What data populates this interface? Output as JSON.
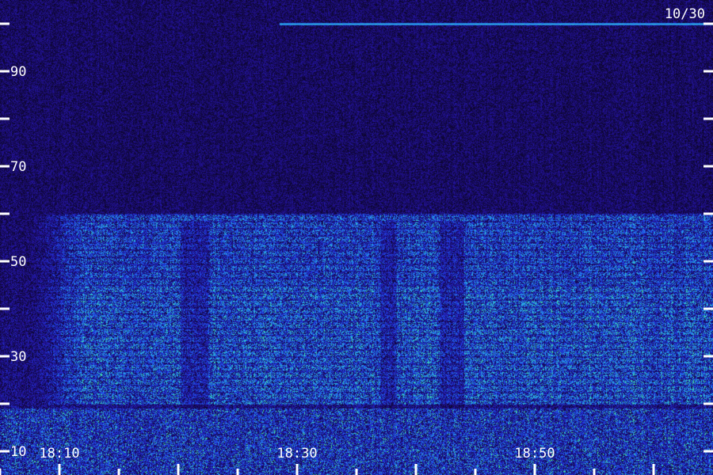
{
  "chart_data": {
    "type": "heatmap",
    "title": "",
    "xlabel": "",
    "ylabel": "",
    "date_label": "10/30",
    "x_tick_labels": [
      "18:10",
      "18:30",
      "18:50"
    ],
    "y_tick_labels": [
      "10",
      "30",
      "50",
      "70",
      "90"
    ],
    "y_ticks": [
      10,
      20,
      30,
      40,
      50,
      60,
      70,
      80,
      90,
      100
    ],
    "ylim": [
      5,
      105
    ],
    "x_range_minutes": [
      5,
      65
    ],
    "x_major_ticks": [
      10,
      20,
      30,
      40,
      50,
      60
    ],
    "x_minor_ticks": [
      5,
      15,
      25,
      35,
      45,
      55
    ],
    "colormap": [
      "#0a0420",
      "#23129a",
      "#1f3fe6",
      "#27b0e8",
      "#4cf08a"
    ],
    "features": [
      {
        "name": "noise band",
        "y_range": [
          20,
          60
        ],
        "x_range": [
          12,
          65
        ],
        "intensity": 0.55
      },
      {
        "name": "strong low band",
        "y_range": [
          5,
          19
        ],
        "x_range": [
          5,
          65
        ],
        "intensity": 0.85
      },
      {
        "name": "narrow line",
        "y": 100,
        "x_range": [
          28.5,
          65
        ],
        "intensity": 0.75
      }
    ]
  }
}
